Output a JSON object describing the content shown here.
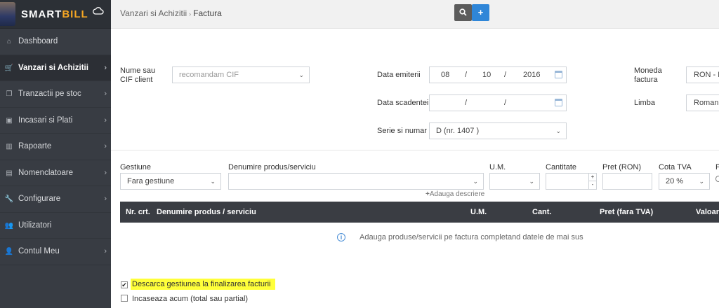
{
  "logo": {
    "part1": "SMART",
    "part2": "BILL"
  },
  "sidebar": {
    "items": [
      {
        "label": "Dashboard",
        "icon": "home-icon"
      },
      {
        "label": "Vanzari si Achizitii",
        "icon": "cart-icon"
      },
      {
        "label": "Tranzactii pe stoc",
        "icon": "copy-icon"
      },
      {
        "label": "Incasari si Plati",
        "icon": "money-icon"
      },
      {
        "label": "Rapoarte",
        "icon": "bar-chart-icon"
      },
      {
        "label": "Nomenclatoare",
        "icon": "list-icon"
      },
      {
        "label": "Configurare",
        "icon": "wrench-icon"
      },
      {
        "label": "Utilizatori",
        "icon": "users-icon"
      },
      {
        "label": "Contul Meu",
        "icon": "user-icon"
      }
    ]
  },
  "breadcrumb": {
    "parent": "Vanzari si Achizitii",
    "separator": "›",
    "current": "Factura"
  },
  "form": {
    "client_label": "Nume sau CIF client",
    "client_placeholder": "recomandam CIF",
    "issue_date_label": "Data emiterii",
    "issue_date": {
      "day": "08",
      "month": "10",
      "year": "2016",
      "sep": "/"
    },
    "due_date_label": "Data scadentei",
    "due_date_sep": "/",
    "series_label": "Serie si numar",
    "series_value": "D (nr. 1407 )",
    "currency_label": "Moneda factura",
    "currency_value": "RON - Le",
    "language_label": "Limba",
    "language_value": "Romana"
  },
  "product_entry": {
    "gestiune_label": "Gestiune",
    "gestiune_value": "Fara gestiune",
    "product_label": "Denumire produs/serviciu",
    "um_label": "U.M.",
    "qty_label": "Cantitate",
    "price_label": "Pret (RON)",
    "vat_label": "Cota TVA",
    "vat_value": "20 %",
    "clipped_label": "P",
    "add_description": "Adauga descriere",
    "spin_up": "+",
    "spin_down": "-"
  },
  "table": {
    "headers": [
      "Nr. crt.",
      "Denumire produs / serviciu",
      "U.M.",
      "Cant.",
      "Pret (fara TVA)",
      "Valoar"
    ],
    "empty_message": "Adauga produse/servicii pe factura completand datele de mai sus",
    "info_glyph": "i"
  },
  "options": {
    "discharge_stock": {
      "label": "Descarca gestiunea la finalizarea facturii",
      "checked": true
    },
    "collect_now": {
      "label": "Incaseaza acum (total sau partial)",
      "checked": false
    }
  }
}
